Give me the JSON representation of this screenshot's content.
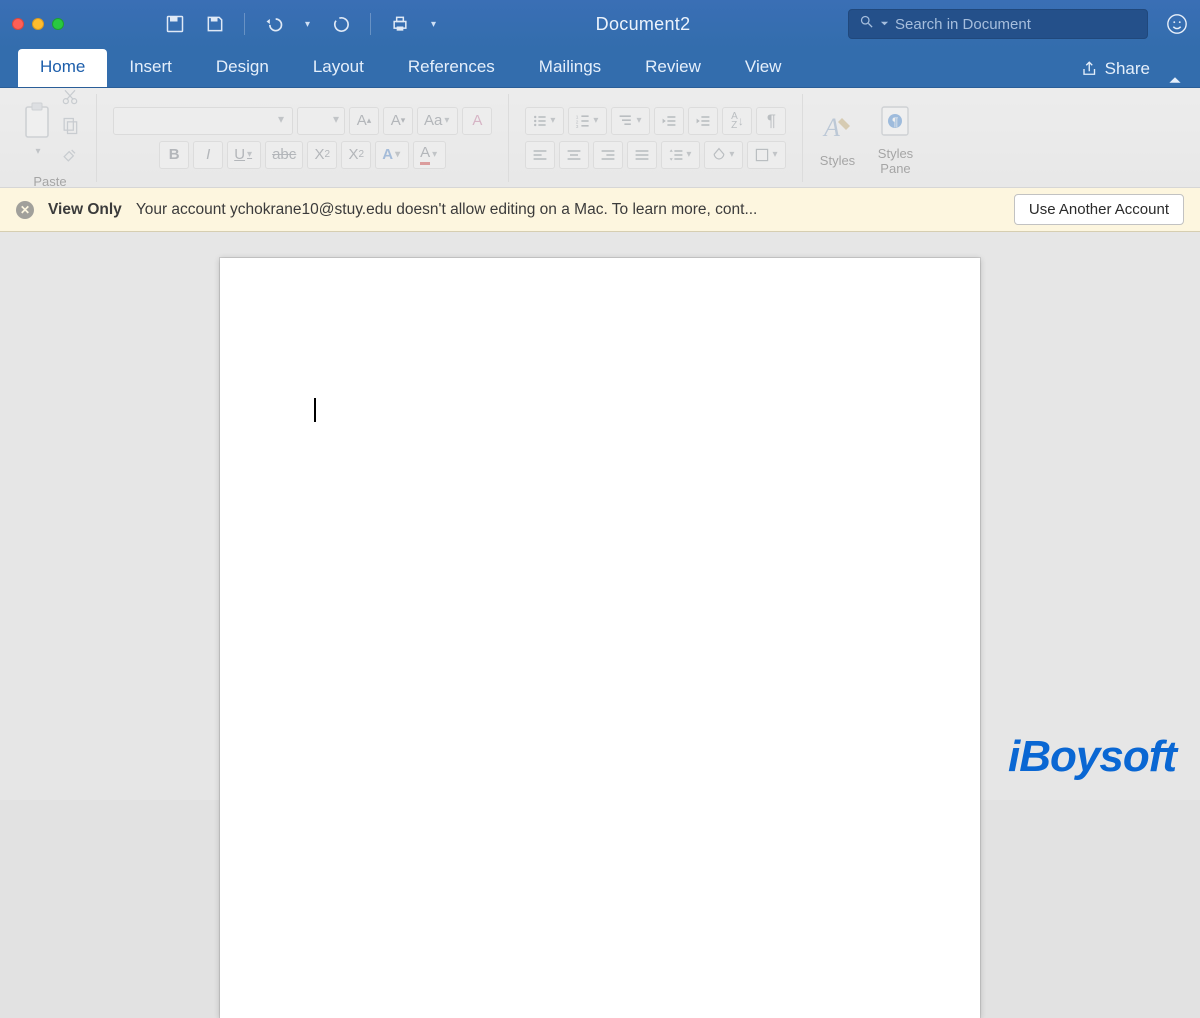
{
  "titlebar": {
    "document_title": "Document2",
    "search_placeholder": "Search in Document"
  },
  "tabs": {
    "items": [
      "Home",
      "Insert",
      "Design",
      "Layout",
      "References",
      "Mailings",
      "Review",
      "View"
    ],
    "active_index": 0,
    "share_label": "Share"
  },
  "ribbon": {
    "paste_label": "Paste",
    "styles_label": "Styles",
    "styles_pane_label": "Styles\nPane",
    "font_btns": {
      "bold": "B",
      "italic": "I",
      "underline": "U",
      "strike": "abc",
      "sub": "X",
      "sup": "X",
      "sub_n": "2",
      "sup_n": "2",
      "grow": "A",
      "shrink": "A",
      "case": "Aa",
      "clear_fmt": "A",
      "text_effects": "A",
      "font_color": "A"
    },
    "sort_btn": {
      "a": "A",
      "z": "Z"
    }
  },
  "infobar": {
    "badge": "View Only",
    "message": "Your account ychokrane10@stuy.edu doesn't allow editing on a Mac. To learn more, cont...",
    "button": "Use Another Account"
  },
  "watermark": {
    "text": "iBoysoft"
  }
}
